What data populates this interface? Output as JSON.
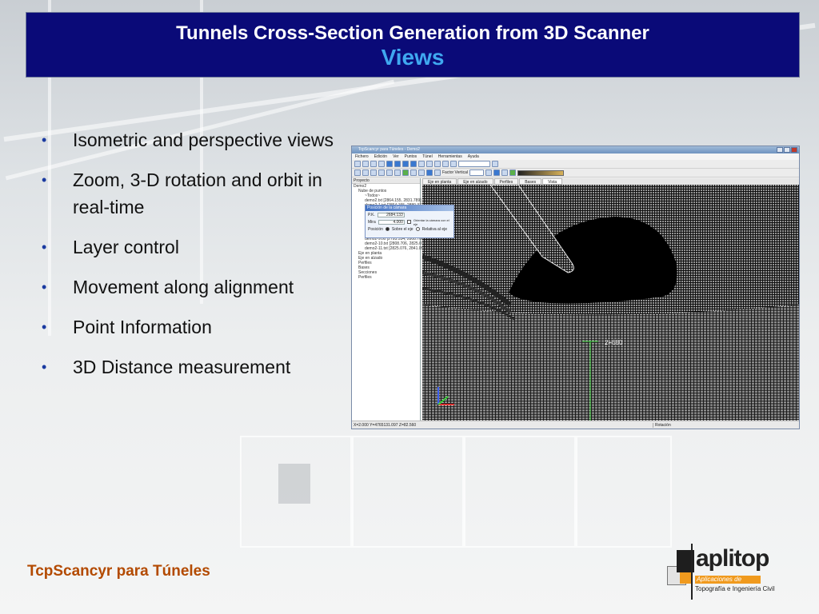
{
  "slide": {
    "title_line1": "Tunnels Cross-Section Generation from 3D Scanner",
    "title_line2": "Views",
    "bullets": [
      "Isometric and perspective views",
      "Zoom, 3-D rotation and orbit in real-time",
      "Layer control",
      "Movement along alignment",
      "Point Information",
      "3D Distance measurement"
    ],
    "bullet_glyph": "•",
    "footer": "TcpScancyr para Túneles"
  },
  "colors": {
    "title_bg": "#0a0a78",
    "title_accent": "#3fa8f0",
    "footer_text": "#b34a00",
    "logo_orange": "#f09a1e"
  },
  "app": {
    "window_title": "TcpScancyr para Túneles - Demo2",
    "menu": [
      "Fichero",
      "Edición",
      "Ver",
      "Puntos",
      "Túnel",
      "Herramientas",
      "Ayuda"
    ],
    "toolbar_label": "Factor Vertical",
    "panel_header": "Proyecto",
    "tree": [
      "Demo2",
      "Nube de puntos",
      "~Todos~",
      "demo2.txt [2864.155, 2831.789]",
      "demo2-1.txt [2864.155, 2880.377]",
      "demo2-8.txt [2777.361, 2793.316]",
      "demo2-9.txt [2793.534, 2808.706]",
      "demo2-10.txt [2808.706, 2825.076]",
      "demo2-11.txt [2825.076, 2841.051]",
      "Eje en planta",
      "Eje en alzado",
      "Perfiles",
      "Bases",
      "Secciones",
      "Perfiles"
    ],
    "view_tabs": [
      "Eje en planta",
      "Eje en alzado",
      "Perfiles",
      "Bases",
      "Vista"
    ],
    "popup": {
      "title": "Posición de la cámara",
      "pk_label": "P.K.",
      "pk_value": "2684.133",
      "mira_label": "Mira",
      "mira_value": "4.000",
      "orient_label": "Orientar la cámara con el eje",
      "position_label": "Posición",
      "option_on_axis": "Sobre el eje",
      "option_relative": "Relativa al eje"
    },
    "station_label": "2+680",
    "status_coords": "X=2.000 Y=4765131.097 Z=82.560",
    "status_mode": "Rotación"
  },
  "logo": {
    "word": "aplitop",
    "band": "Aplicaciones de",
    "subtitle": "Topografía e Ingeniería Civil"
  }
}
